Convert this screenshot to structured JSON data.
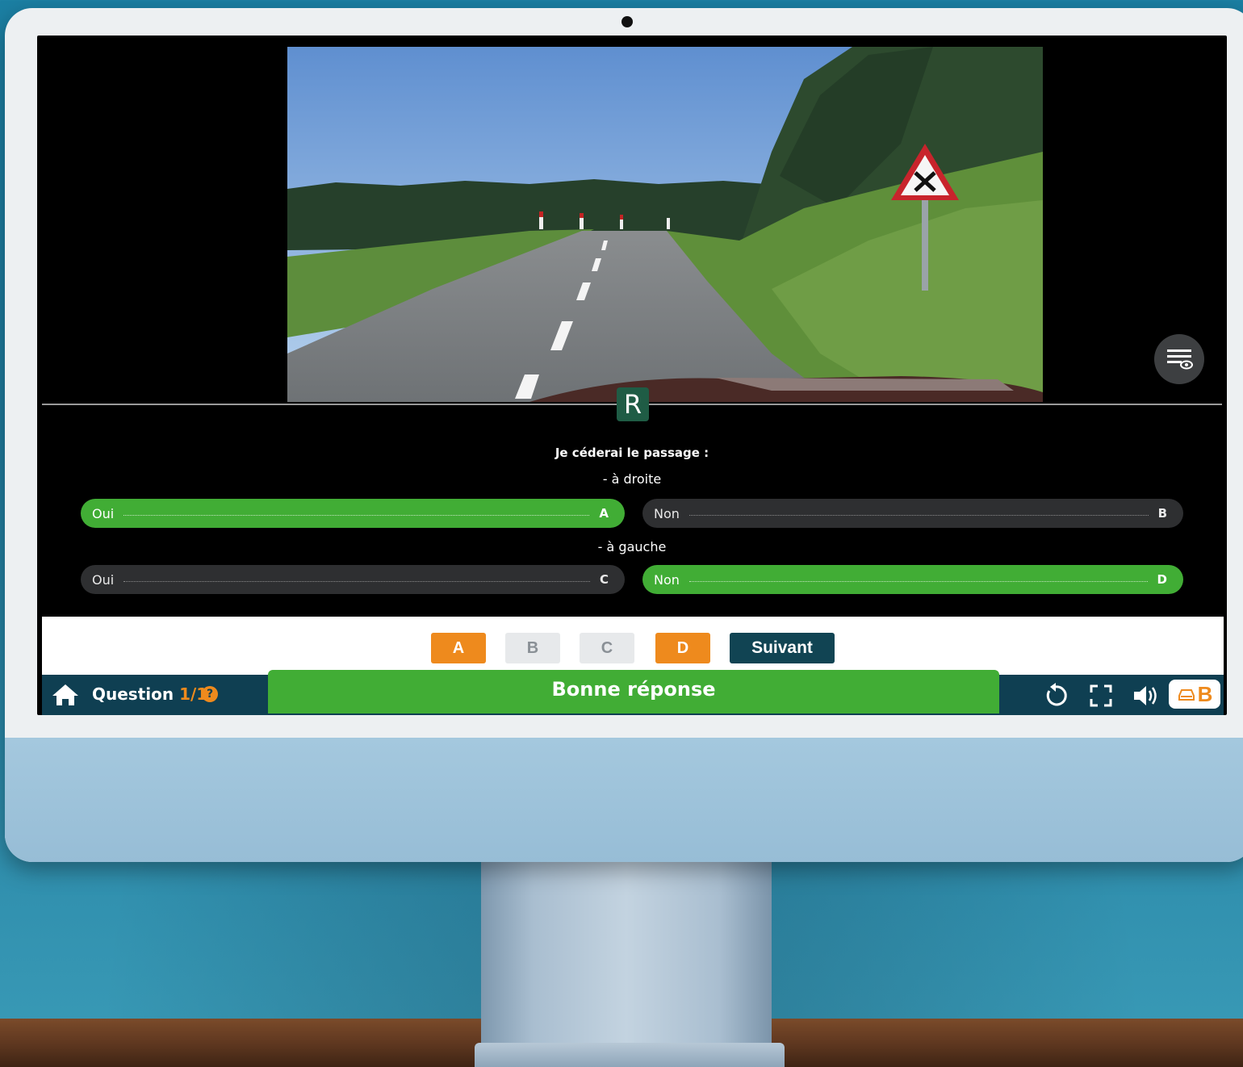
{
  "question": {
    "title": "Je céderai le passage :",
    "groups": [
      {
        "label": "- à droite",
        "options": [
          {
            "text": "Oui",
            "letter": "A",
            "selected": true
          },
          {
            "text": "Non",
            "letter": "B",
            "selected": false
          }
        ]
      },
      {
        "label": "- à gauche",
        "options": [
          {
            "text": "Oui",
            "letter": "C",
            "selected": false
          },
          {
            "text": "Non",
            "letter": "D",
            "selected": true
          }
        ]
      }
    ]
  },
  "overlay": {
    "badge": "R",
    "settings_icon": "subtitles-view-icon"
  },
  "answer_keys": [
    {
      "label": "A",
      "active": true
    },
    {
      "label": "B",
      "active": false
    },
    {
      "label": "C",
      "active": false
    },
    {
      "label": "D",
      "active": true
    }
  ],
  "next_label": "Suivant",
  "status": {
    "question_word": "Question",
    "question_number": "1/1",
    "help_symbol": "?",
    "result": "Bonne réponse",
    "brand_letter": "B"
  },
  "colors": {
    "correct_green": "#41ad35",
    "accent_orange": "#ee8a1d",
    "bar_navy": "#0f3f52",
    "badge_green": "#1f5c45"
  }
}
